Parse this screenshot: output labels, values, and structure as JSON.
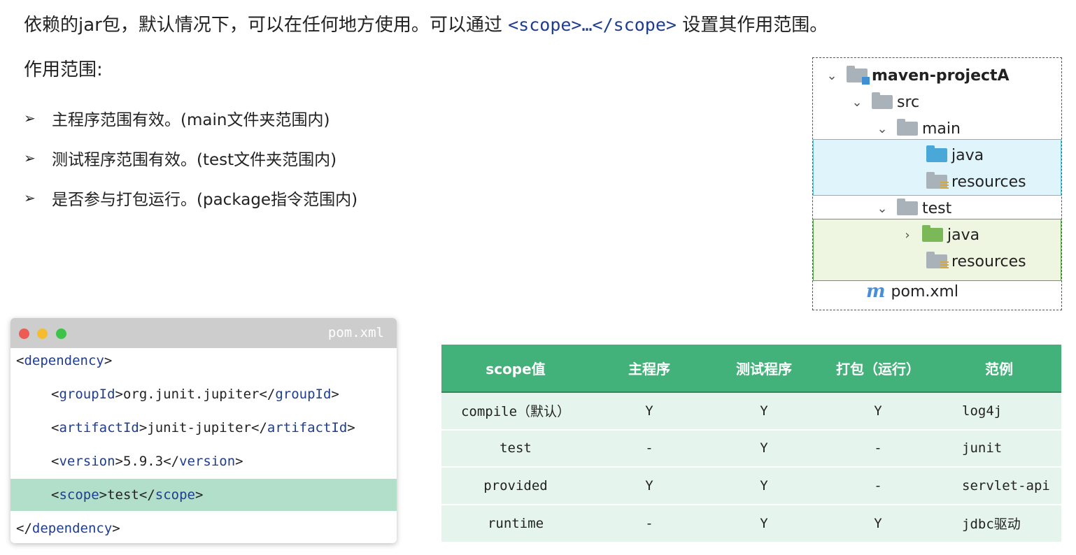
{
  "intro": {
    "text_before": "依赖的jar包，默认情况下，可以在任何地方使用。可以通过",
    "code": "<scope>…</scope>",
    "text_after": "设置其作用范围。"
  },
  "scope_title": "作用范围:",
  "bullets": [
    {
      "text": "主程序范围有效。(main文件夹范围内)"
    },
    {
      "text": "测试程序范围有效。(test文件夹范围内)"
    },
    {
      "text": "是否参与打包运行。(package指令范围内)"
    }
  ],
  "tree": {
    "project": "maven-projectA",
    "src": "src",
    "main": "main",
    "main_java": "java",
    "main_resources": "resources",
    "test": "test",
    "test_java": "java",
    "test_resources": "resources",
    "pom": "pom.xml"
  },
  "code_window": {
    "filename": "pom.xml",
    "lines": [
      {
        "indent": 0,
        "open": "dependency",
        "value": "",
        "close": ""
      },
      {
        "indent": 1,
        "open": "groupId",
        "value": "org.junit.jupiter",
        "close": "groupId"
      },
      {
        "indent": 1,
        "open": "artifactId",
        "value": "junit-jupiter",
        "close": "artifactId"
      },
      {
        "indent": 1,
        "open": "version",
        "value": "5.9.3",
        "close": "version"
      },
      {
        "indent": 1,
        "open": "scope",
        "value": "test",
        "close": "scope"
      },
      {
        "indent": 0,
        "open": "",
        "value": "",
        "close": "dependency"
      }
    ]
  },
  "table": {
    "headers": [
      "scope值",
      "主程序",
      "测试程序",
      "打包（运行）",
      "范例"
    ],
    "rows": [
      [
        "compile（默认）",
        "Y",
        "Y",
        "Y",
        "log4j"
      ],
      [
        "test",
        "-",
        "Y",
        "-",
        "junit"
      ],
      [
        "provided",
        "Y",
        "Y",
        "-",
        "servlet-api"
      ],
      [
        "runtime",
        "-",
        "Y",
        "Y",
        "jdbc驱动"
      ]
    ]
  },
  "colors": {
    "header_green": "#42b27a",
    "row_bg": "#e6f4ee",
    "code_highlight": "#b1dfca",
    "tag_blue": "#1f3d8f"
  }
}
